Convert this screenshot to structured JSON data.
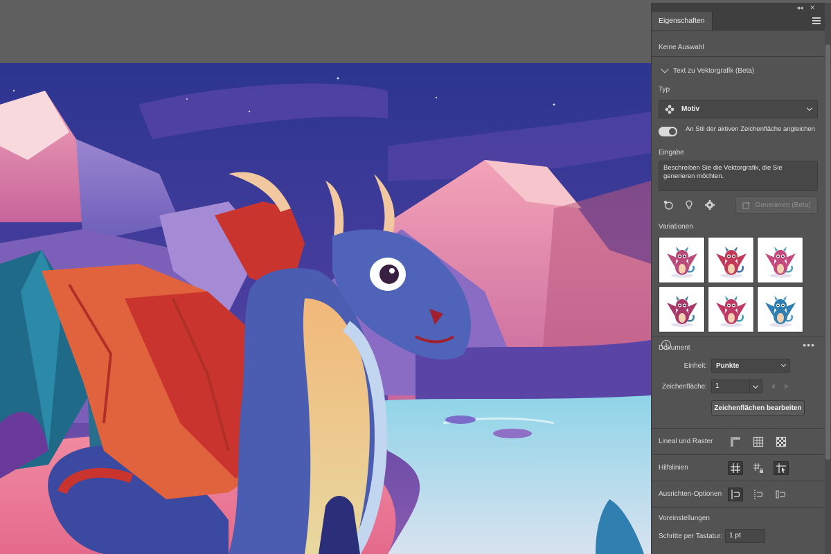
{
  "panel": {
    "tab_label": "Eigenschaften",
    "selection_status": "Keine Auswahl"
  },
  "text_to_vector": {
    "section_title": "Text zu Vektorgrafik (Beta)",
    "type_label": "Typ",
    "type_value": "Motiv",
    "toggle_label": "An Stil der aktiven Zeichenfläche angleichen",
    "toggle_on": true,
    "input_label": "Eingabe",
    "prompt_placeholder": "Beschreiben Sie die Vektorgrafik, die Sie generieren möchten.",
    "generate_button": "Generieren (Beta)",
    "variations_label": "Variationen",
    "variations": [
      {
        "color": "#b94a7a",
        "accent": "#3f8fb0"
      },
      {
        "color": "#c23a5a",
        "accent": "#3b6fa8"
      },
      {
        "color": "#c44a7e",
        "accent": "#4aa3b8"
      },
      {
        "color": "#a8386a",
        "accent": "#3a7fa0"
      },
      {
        "color": "#c03a66",
        "accent": "#3a9fb2"
      },
      {
        "color": "#2f7fb0",
        "accent": "#4a9ad0"
      }
    ]
  },
  "document": {
    "section_title": "Dokument",
    "unit_label": "Einheit:",
    "unit_value": "Punkte",
    "artboard_label": "Zeichenfläche:",
    "artboard_value": "1",
    "edit_artboards_button": "Zeichenflächen bearbeiten"
  },
  "rulers_grid": {
    "label": "Lineal und Raster"
  },
  "guides": {
    "label": "Hilfslinien"
  },
  "align_options": {
    "label": "Ausrichten-Optionen"
  },
  "preferences": {
    "label": "Voreinstellungen",
    "keyboard_step_label": "Schritte per Tastatur:",
    "keyboard_step_value": "1 pt"
  },
  "colors": {
    "panel_bg": "#535353",
    "app_bg": "#5f5f5f",
    "sky": "#2e3a8f",
    "dragon_body": "#4a5db0",
    "dragon_wing": "#c9352e"
  }
}
